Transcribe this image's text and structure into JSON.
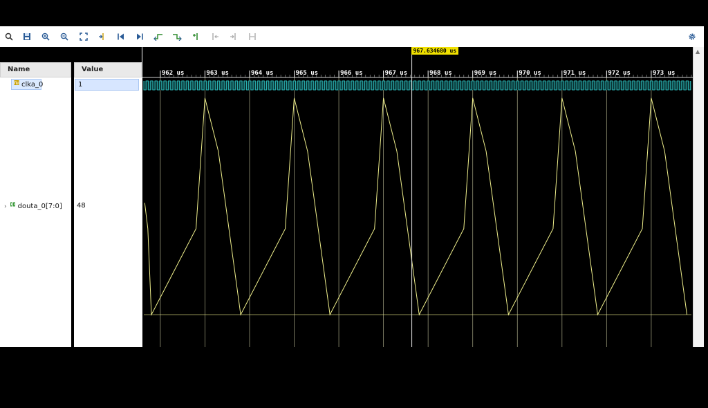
{
  "toolbar": {
    "buttons": [
      {
        "icon": "search-icon"
      },
      {
        "icon": "save-icon"
      },
      {
        "icon": "zoom-in-icon"
      },
      {
        "icon": "zoom-out-icon"
      },
      {
        "icon": "zoom-fit-icon"
      },
      {
        "icon": "go-to-cursor-icon"
      },
      {
        "icon": "go-to-start-icon"
      },
      {
        "icon": "go-to-end-icon"
      },
      {
        "icon": "previous-transition-icon"
      },
      {
        "icon": "next-transition-icon"
      },
      {
        "icon": "add-marker-icon"
      },
      {
        "icon": "previous-marker-icon"
      },
      {
        "icon": "next-marker-icon"
      },
      {
        "icon": "swap-cursors-icon"
      }
    ],
    "settings_icon": "gear-icon"
  },
  "signal_panel": {
    "name_header": "Name",
    "value_header": "Value",
    "signals": [
      {
        "name": "clka_0",
        "value": "1",
        "icon": "clock-signal-icon"
      },
      {
        "name": "douta_0[7:0]",
        "value": "48",
        "icon": "bus-signal-icon"
      }
    ]
  },
  "waveform": {
    "time_unit": "us",
    "ticks": [
      {
        "t": 962,
        "label": "962 us"
      },
      {
        "t": 963,
        "label": "963 us"
      },
      {
        "t": 964,
        "label": "964 us"
      },
      {
        "t": 965,
        "label": "965 us"
      },
      {
        "t": 966,
        "label": "966 us"
      },
      {
        "t": 967,
        "label": "967 us"
      },
      {
        "t": 968,
        "label": "968 us"
      },
      {
        "t": 969,
        "label": "969 us"
      },
      {
        "t": 970,
        "label": "970 us"
      },
      {
        "t": 971,
        "label": "971 us"
      },
      {
        "t": 972,
        "label": "972 us"
      },
      {
        "t": 973,
        "label": "973 us"
      }
    ],
    "view_start_us": 961.63,
    "view_end_us": 973.9,
    "cursor_time_us": 967.63468,
    "cursor_label": "967.634680 us",
    "clock_color": "#2ab3b3",
    "analog_color": "#f0f08c",
    "grid_color": "#c8c8a0",
    "cursor_color": "#e8e8e8",
    "douta_period_us": 2.0,
    "douta_min": 0,
    "douta_max": 255,
    "douta_samples": [
      {
        "t": 961.65,
        "v": 130
      },
      {
        "t": 961.72,
        "v": 100
      },
      {
        "t": 961.8,
        "v": 0
      },
      {
        "t": 962.8,
        "v": 100
      },
      {
        "t": 963.0,
        "v": 252
      },
      {
        "t": 963.3,
        "v": 190
      },
      {
        "t": 963.8,
        "v": 0
      }
    ]
  }
}
